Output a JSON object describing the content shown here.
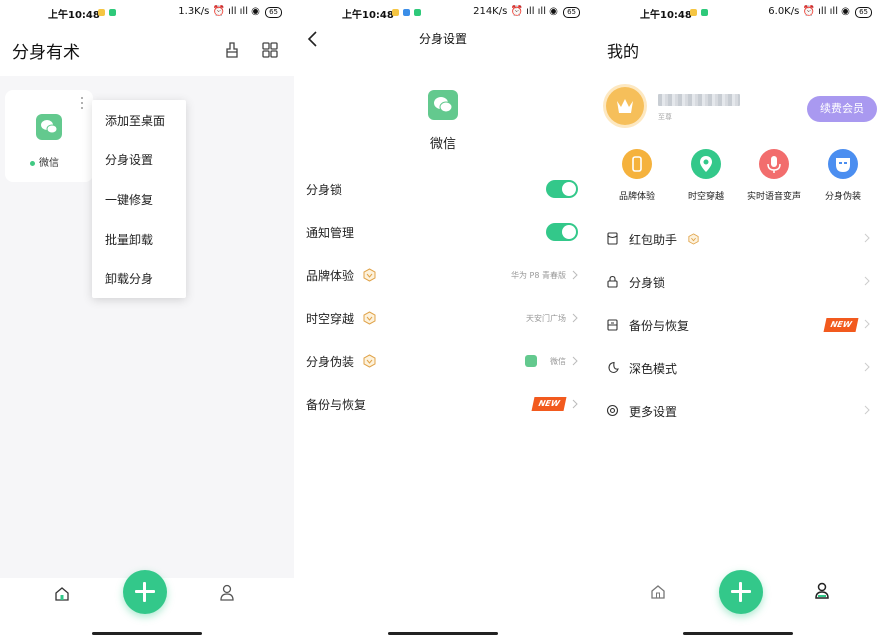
{
  "status_bars": [
    {
      "time": "上午10:48",
      "speed": "1.3K/s",
      "battery": "65",
      "dot_colors": [
        "#f5c542",
        "#2ec97a"
      ]
    },
    {
      "time": "上午10:48",
      "speed": "214K/s",
      "battery": "65",
      "dot_colors": [
        "#f5c542",
        "#3b8ee8",
        "#2ec97a"
      ]
    },
    {
      "time": "上午10:48",
      "speed": "6.0K/s",
      "battery": "65",
      "dot_colors": [
        "#f5c542",
        "#2ec97a"
      ]
    }
  ],
  "home": {
    "title": "分身有术",
    "header_icons": [
      "clean-brush-icon",
      "grid-apps-icon"
    ],
    "app_card": {
      "label": "微信",
      "icon": "wechat-icon"
    },
    "context_menu": [
      "添加至桌面",
      "分身设置",
      "一键修复",
      "批量卸载",
      "卸载分身"
    ],
    "bottom_nav": [
      "home-icon",
      "add-icon",
      "profile-icon"
    ]
  },
  "settings": {
    "title": "分身设置",
    "app_name": "微信",
    "rows": [
      {
        "label": "分身锁",
        "kind": "toggle",
        "on": true
      },
      {
        "label": "通知管理",
        "kind": "toggle",
        "on": true
      },
      {
        "label": "品牌体验",
        "vip": true,
        "value": "华为 P8 青春版"
      },
      {
        "label": "时空穿越",
        "vip": true,
        "value": "天安门广场"
      },
      {
        "label": "分身伪装",
        "vip": true,
        "value": "微信"
      },
      {
        "label": "备份与恢复",
        "badge": "NEW"
      }
    ]
  },
  "mine": {
    "title": "我的",
    "tier": "至尊",
    "renew_button": "续费会员",
    "features": [
      {
        "label": "品牌体验",
        "color": "#f5b23d",
        "icon": "phone-icon"
      },
      {
        "label": "时空穿越",
        "color": "#33c88a",
        "icon": "location-icon"
      },
      {
        "label": "实时语音变声",
        "color": "#f26d6d",
        "icon": "microphone-icon"
      },
      {
        "label": "分身伪装",
        "color": "#4b8ef0",
        "icon": "mask-icon"
      }
    ],
    "menu": [
      {
        "label": "红包助手",
        "vip": true,
        "icon": "red-packet-icon"
      },
      {
        "label": "分身锁",
        "icon": "lock-icon"
      },
      {
        "label": "备份与恢复",
        "badge": "NEW",
        "icon": "backup-icon"
      },
      {
        "label": "深色模式",
        "icon": "moon-icon"
      },
      {
        "label": "更多设置",
        "icon": "settings-icon"
      }
    ],
    "bottom_nav": [
      "home-icon",
      "add-icon",
      "profile-icon"
    ]
  },
  "colors": {
    "accent": "#33c88a",
    "vip": "#e0a34a",
    "new_badge": "#f25a1e",
    "renew": "#a999f0"
  }
}
